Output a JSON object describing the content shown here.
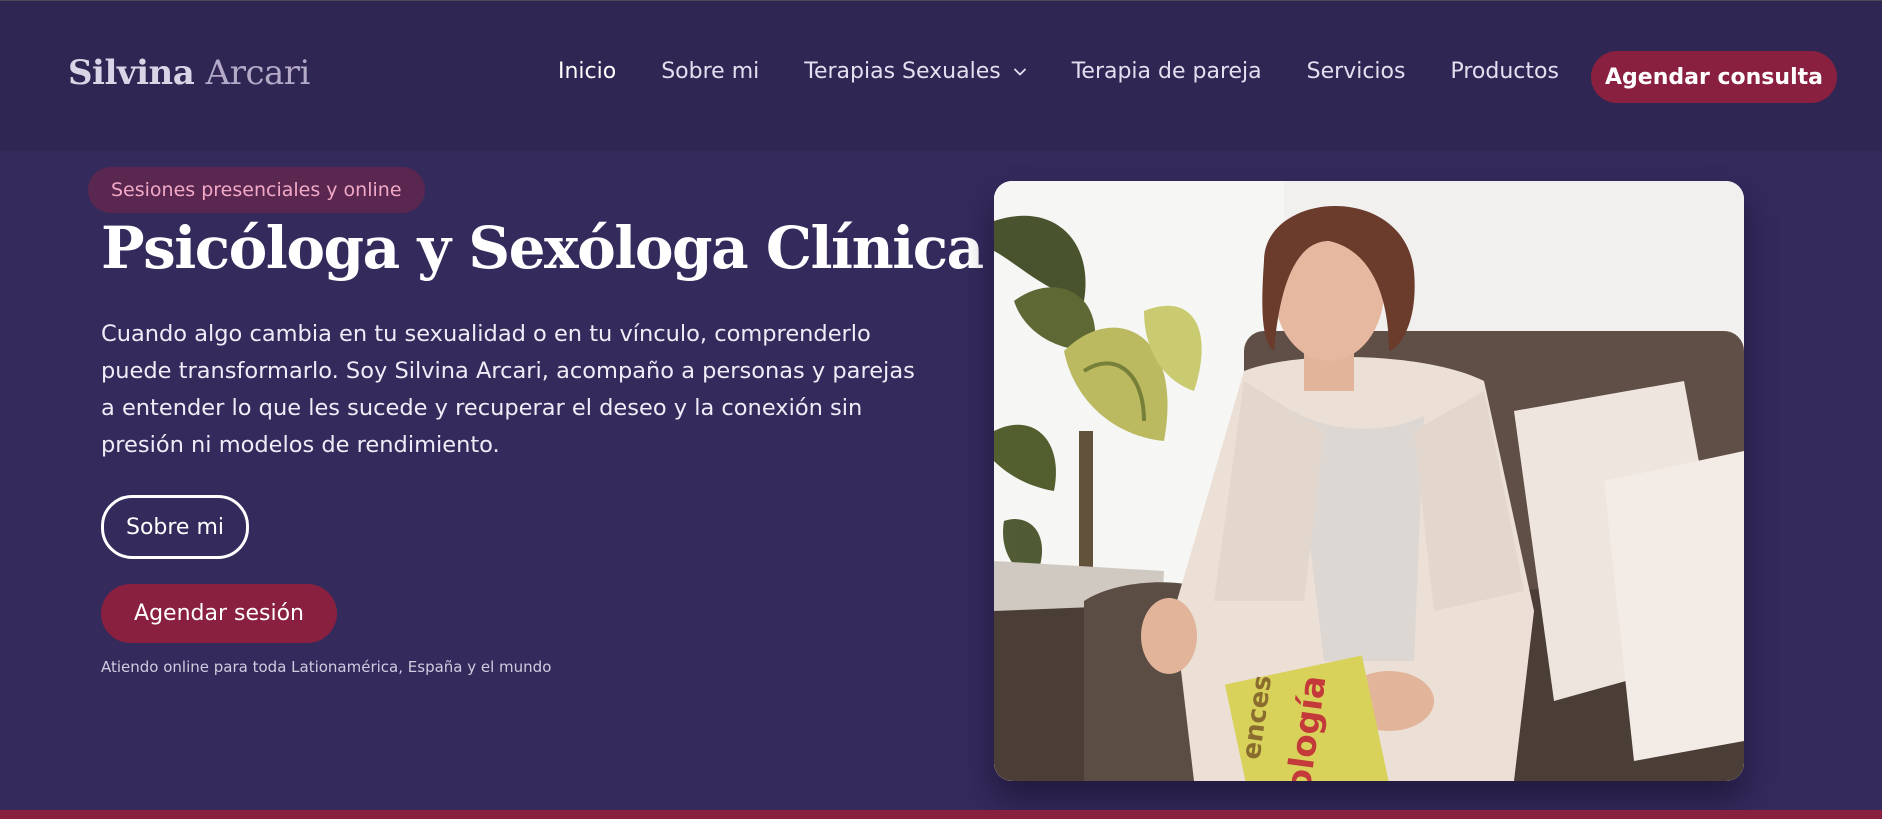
{
  "brand": {
    "name_part1": "Silvina",
    "name_part2": "Arcari"
  },
  "nav": {
    "items": [
      {
        "label": "Inicio"
      },
      {
        "label": "Sobre mi"
      },
      {
        "label": "Terapias Sexuales"
      },
      {
        "label": "Terapia de pareja"
      },
      {
        "label": "Servicios"
      },
      {
        "label": "Productos"
      }
    ],
    "cta_label": "Agendar consulta"
  },
  "hero": {
    "badge": "Sesiones presenciales y online",
    "title": "Psicóloga y Sexóloga Clínica",
    "description": "Cuando algo cambia en tu sexualidad o en tu vínculo, comprenderlo puede transformarlo. Soy Silvina Arcari, acompaño a personas y parejas a entender lo que les sucede y recuperar el deseo y la conexión sin presión ni modelos de rendimiento.",
    "secondary_button": "Sobre mi",
    "primary_button": "Agendar sesión",
    "note": "Atiendo online para toda Lationamérica, España y el mundo",
    "book_text_1": "ences",
    "book_text_2": "ología"
  },
  "icons": {
    "dropdown": "chevron-down-icon"
  },
  "colors": {
    "nav_bg": "#2f2653",
    "hero_bg": "#342a5c",
    "accent": "#8a2040",
    "badge_bg": "#5a2751",
    "badge_text": "#f2a9c6"
  }
}
